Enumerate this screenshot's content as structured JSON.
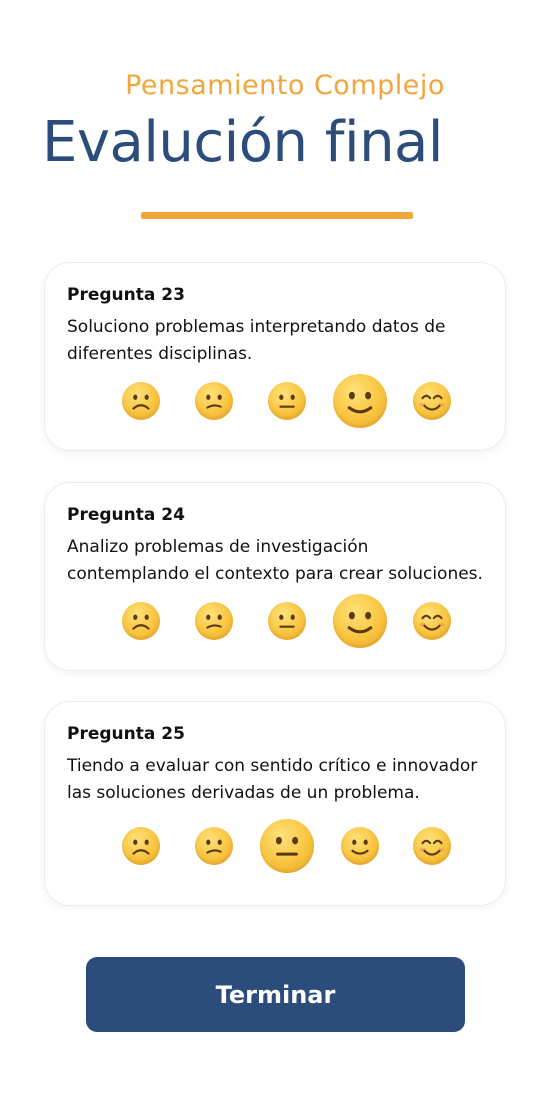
{
  "header": {
    "subtitle": "Pensamiento Complejo",
    "title": "Evalución final"
  },
  "rating_faces": [
    "frowning-face",
    "confused-face",
    "neutral-face",
    "slightly-smiling-face",
    "smiling-face"
  ],
  "questions": [
    {
      "label": "Pregunta 23",
      "line1": "Soluciono problemas interpretando datos de",
      "line2": "diferentes disciplinas.",
      "selected": "slightly-smiling-face"
    },
    {
      "label": "Pregunta 24",
      "line1": "Analizo problemas de investigación",
      "line2": "contemplando el contexto para crear soluciones.",
      "selected": "slightly-smiling-face"
    },
    {
      "label": "Pregunta 25",
      "line1": "Tiendo a evaluar con sentido crítico e innovador",
      "line2": "las soluciones derivadas de un problema.",
      "selected": "neutral-face"
    }
  ],
  "finish_button": {
    "label": "Terminar"
  },
  "colors": {
    "navy": "#2c4d7c",
    "orange": "#f0a63a"
  }
}
